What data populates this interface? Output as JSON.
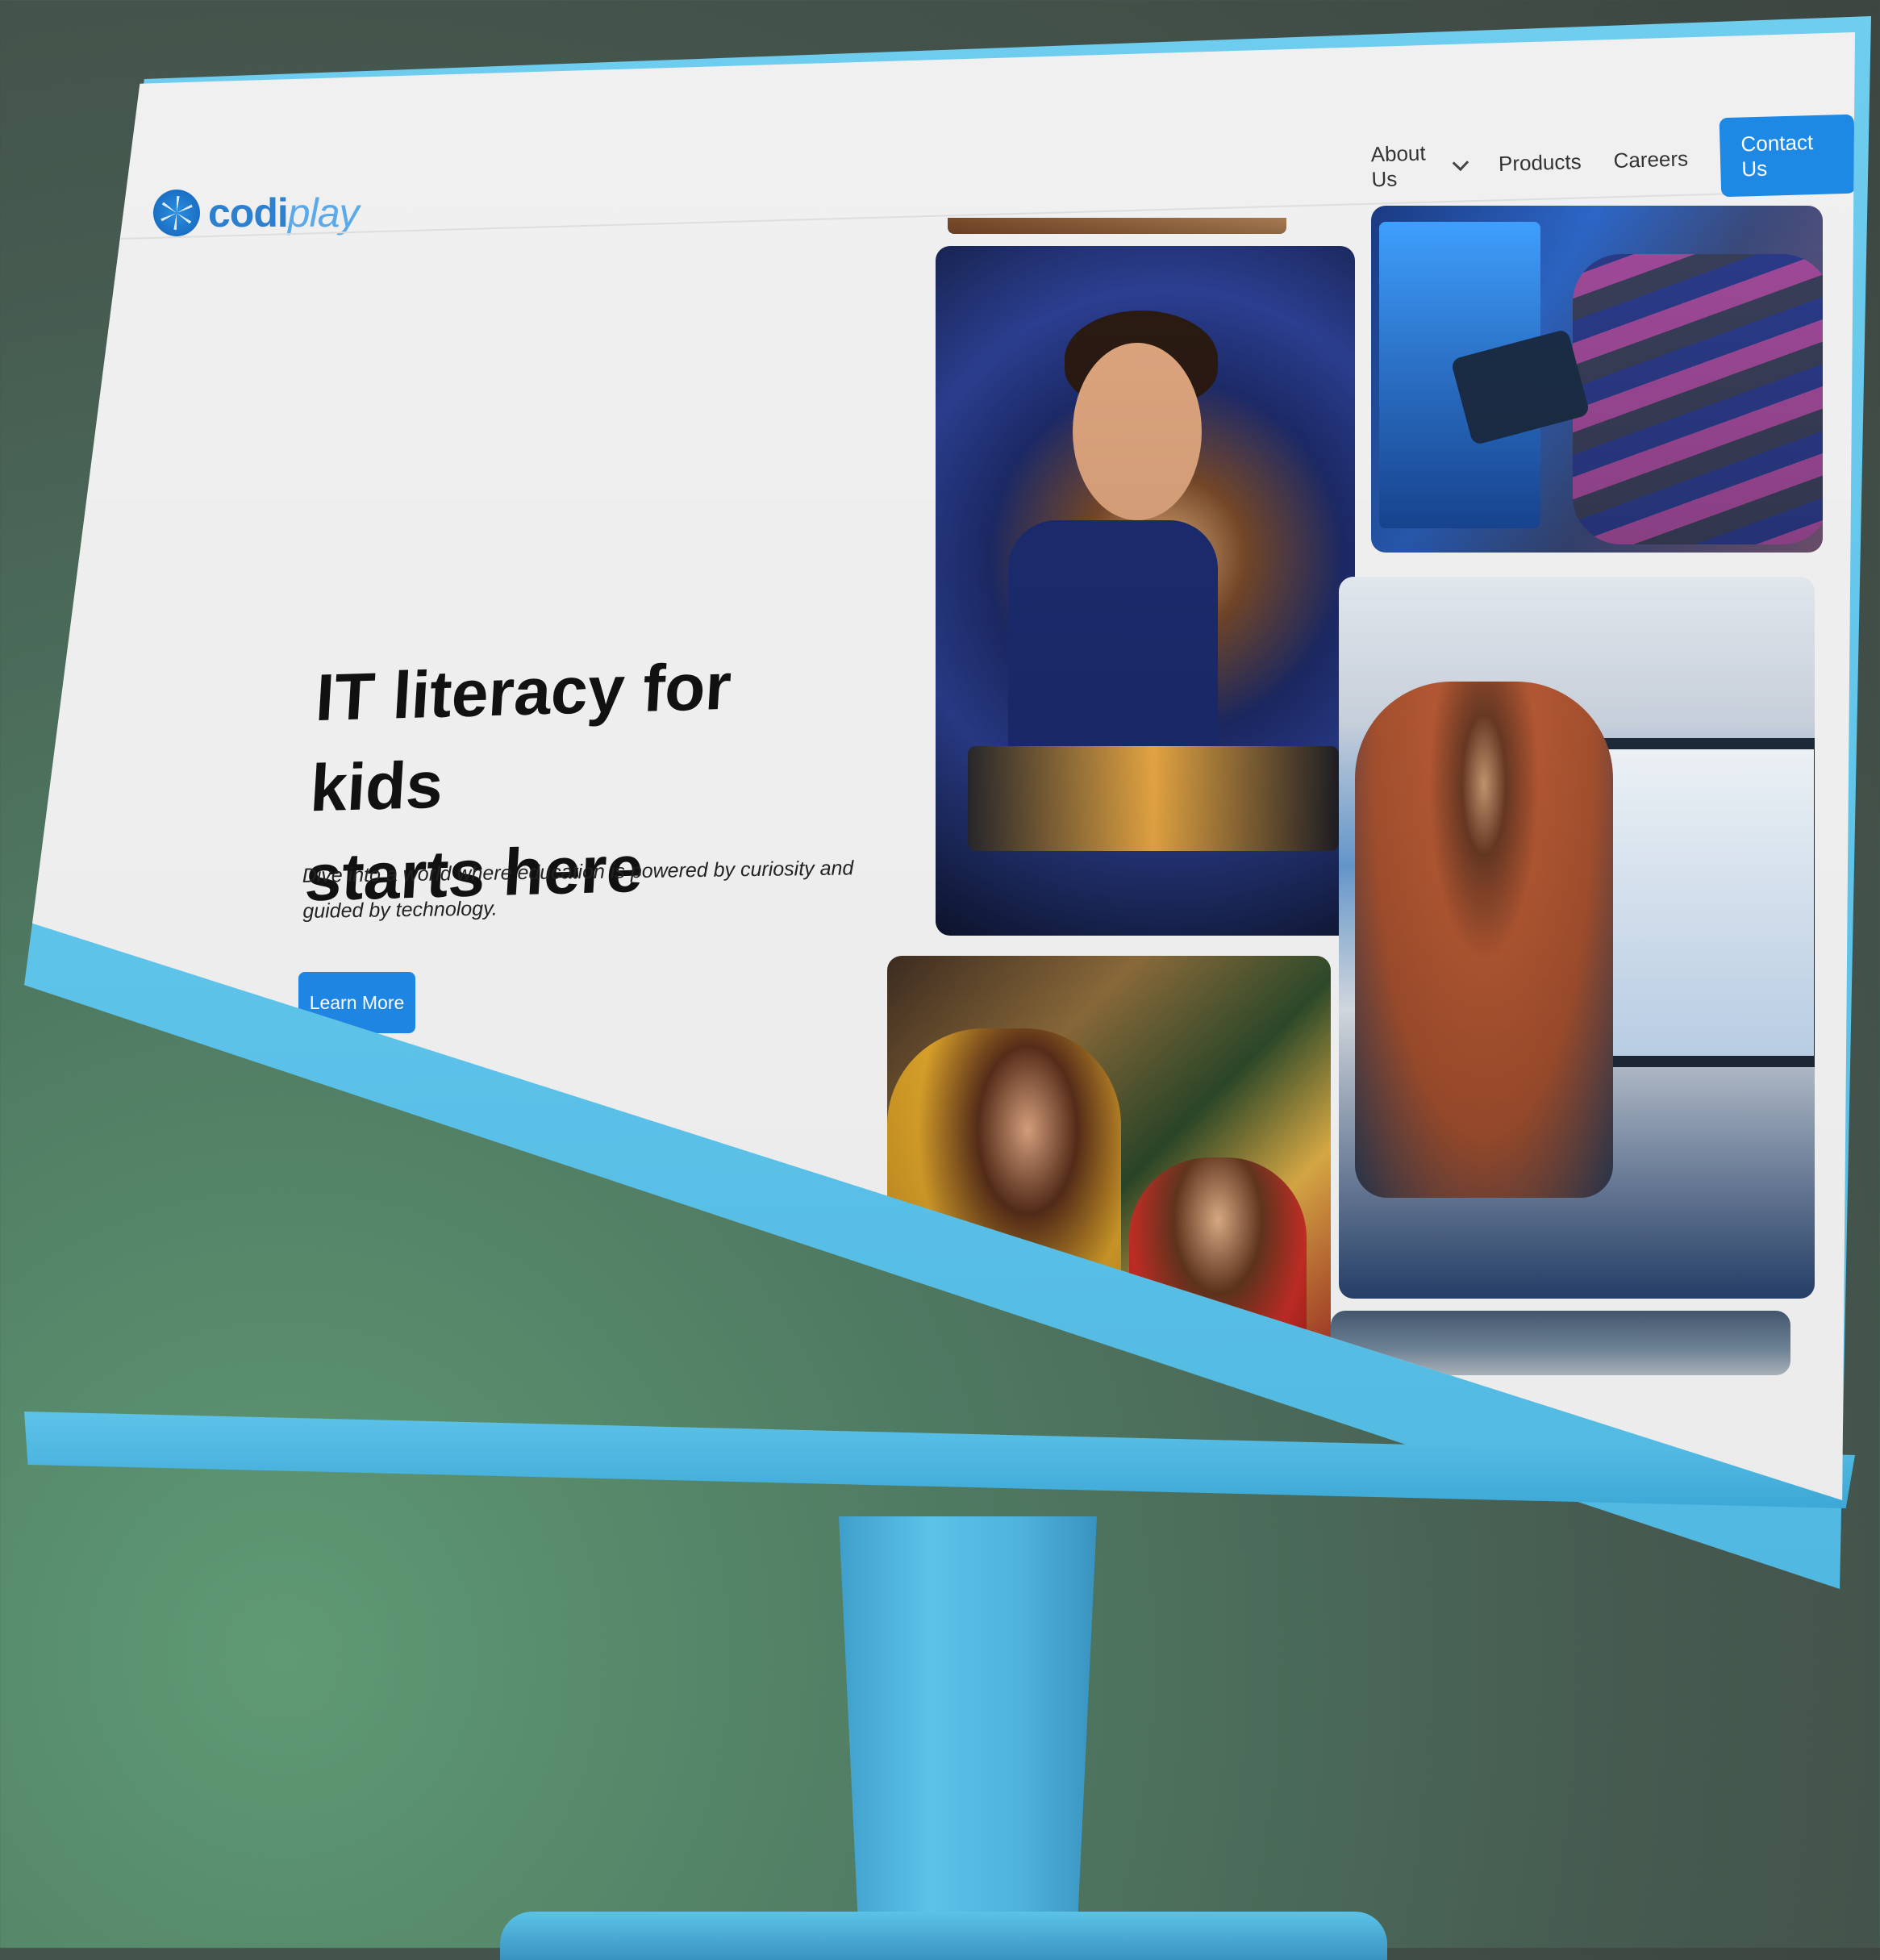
{
  "brand": {
    "name_part1": "codi",
    "name_part2": "play",
    "logo_icon": "geodesic-sphere-icon",
    "primary_color": "#1e88e5",
    "frame_color": "#5fc5ea"
  },
  "nav": {
    "items": [
      {
        "label": "About Us",
        "has_dropdown": true
      },
      {
        "label": "Products",
        "has_dropdown": false
      },
      {
        "label": "Careers",
        "has_dropdown": false
      }
    ],
    "cta_label": "Contact Us"
  },
  "hero": {
    "headline_line1": "IT literacy for kids",
    "headline_line2": "starts here",
    "subtext": "Dive into a world where education is powered by curiosity and guided by technology.",
    "button_label": "Learn More"
  },
  "gallery": {
    "images": [
      {
        "id": "boy-electronics"
      },
      {
        "id": "child-tablet"
      },
      {
        "id": "teacher-whiteboard"
      },
      {
        "id": "mother-child"
      },
      {
        "id": "classroom-partial"
      }
    ]
  }
}
